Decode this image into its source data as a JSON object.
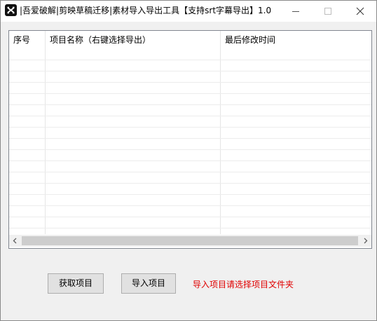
{
  "window": {
    "title": "|吾爱破解|剪映草稿迁移|素材导入导出工具【支持srt字幕导出】1.0",
    "icon": "capcut-logo-icon"
  },
  "list": {
    "columns": [
      "序号",
      "项目名称（右键选择导出）",
      "最后修改时间"
    ],
    "rows": []
  },
  "buttons": {
    "fetch_label": "获取项目",
    "import_label": "导入项目"
  },
  "hint": {
    "text": "导入项目请选择项目文件夹",
    "color": "#e00000"
  }
}
